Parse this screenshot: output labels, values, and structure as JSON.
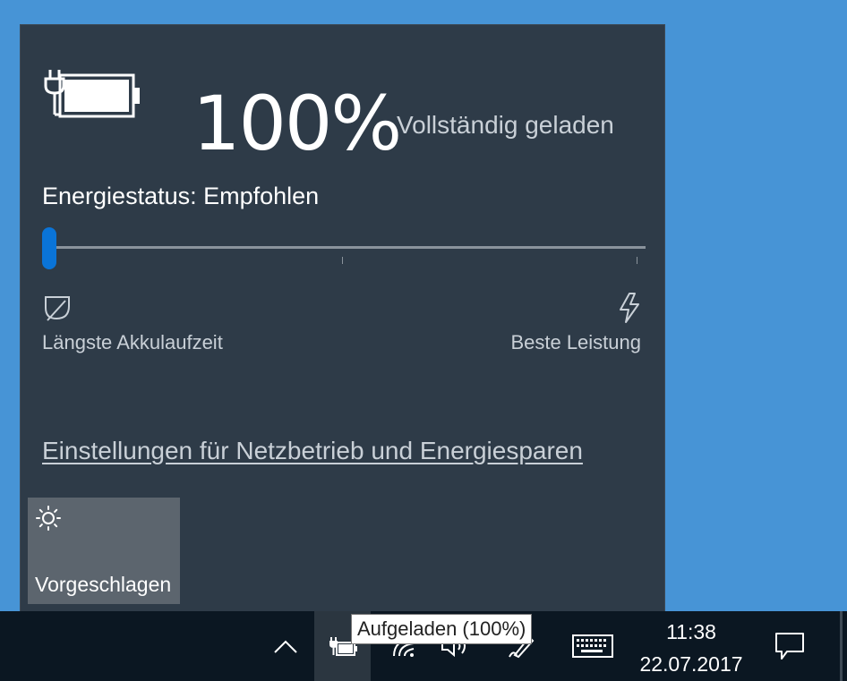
{
  "battery": {
    "percent_text": "100%",
    "status": "Vollständig geladen",
    "charge_level": 1.0
  },
  "power_mode": {
    "label": "Energiestatus: Empfohlen",
    "slider_position": 0,
    "left_label": "Längste Akkulaufzeit",
    "right_label": "Beste Leistung"
  },
  "settings_link": "Einstellungen für Netzbetrieb und Energiesparen",
  "quick_action": {
    "label": "Vorgeschlagen",
    "icon": "brightness-icon"
  },
  "taskbar": {
    "tooltip": "Aufgeladen (100%)",
    "time": "11:38",
    "date": "22.07.2017",
    "icons": [
      "chevron-up-icon",
      "power-plug-battery-icon",
      "wifi-icon",
      "volume-icon",
      "pen-icon",
      "touch-keyboard-icon",
      "action-center-icon"
    ]
  },
  "colors": {
    "desktop": "#4794d6",
    "flyout_bg": "#2e3b48",
    "accent": "#0a74d8",
    "taskbar_bg": "#0b1722",
    "tile_bg": "#5c656e"
  }
}
